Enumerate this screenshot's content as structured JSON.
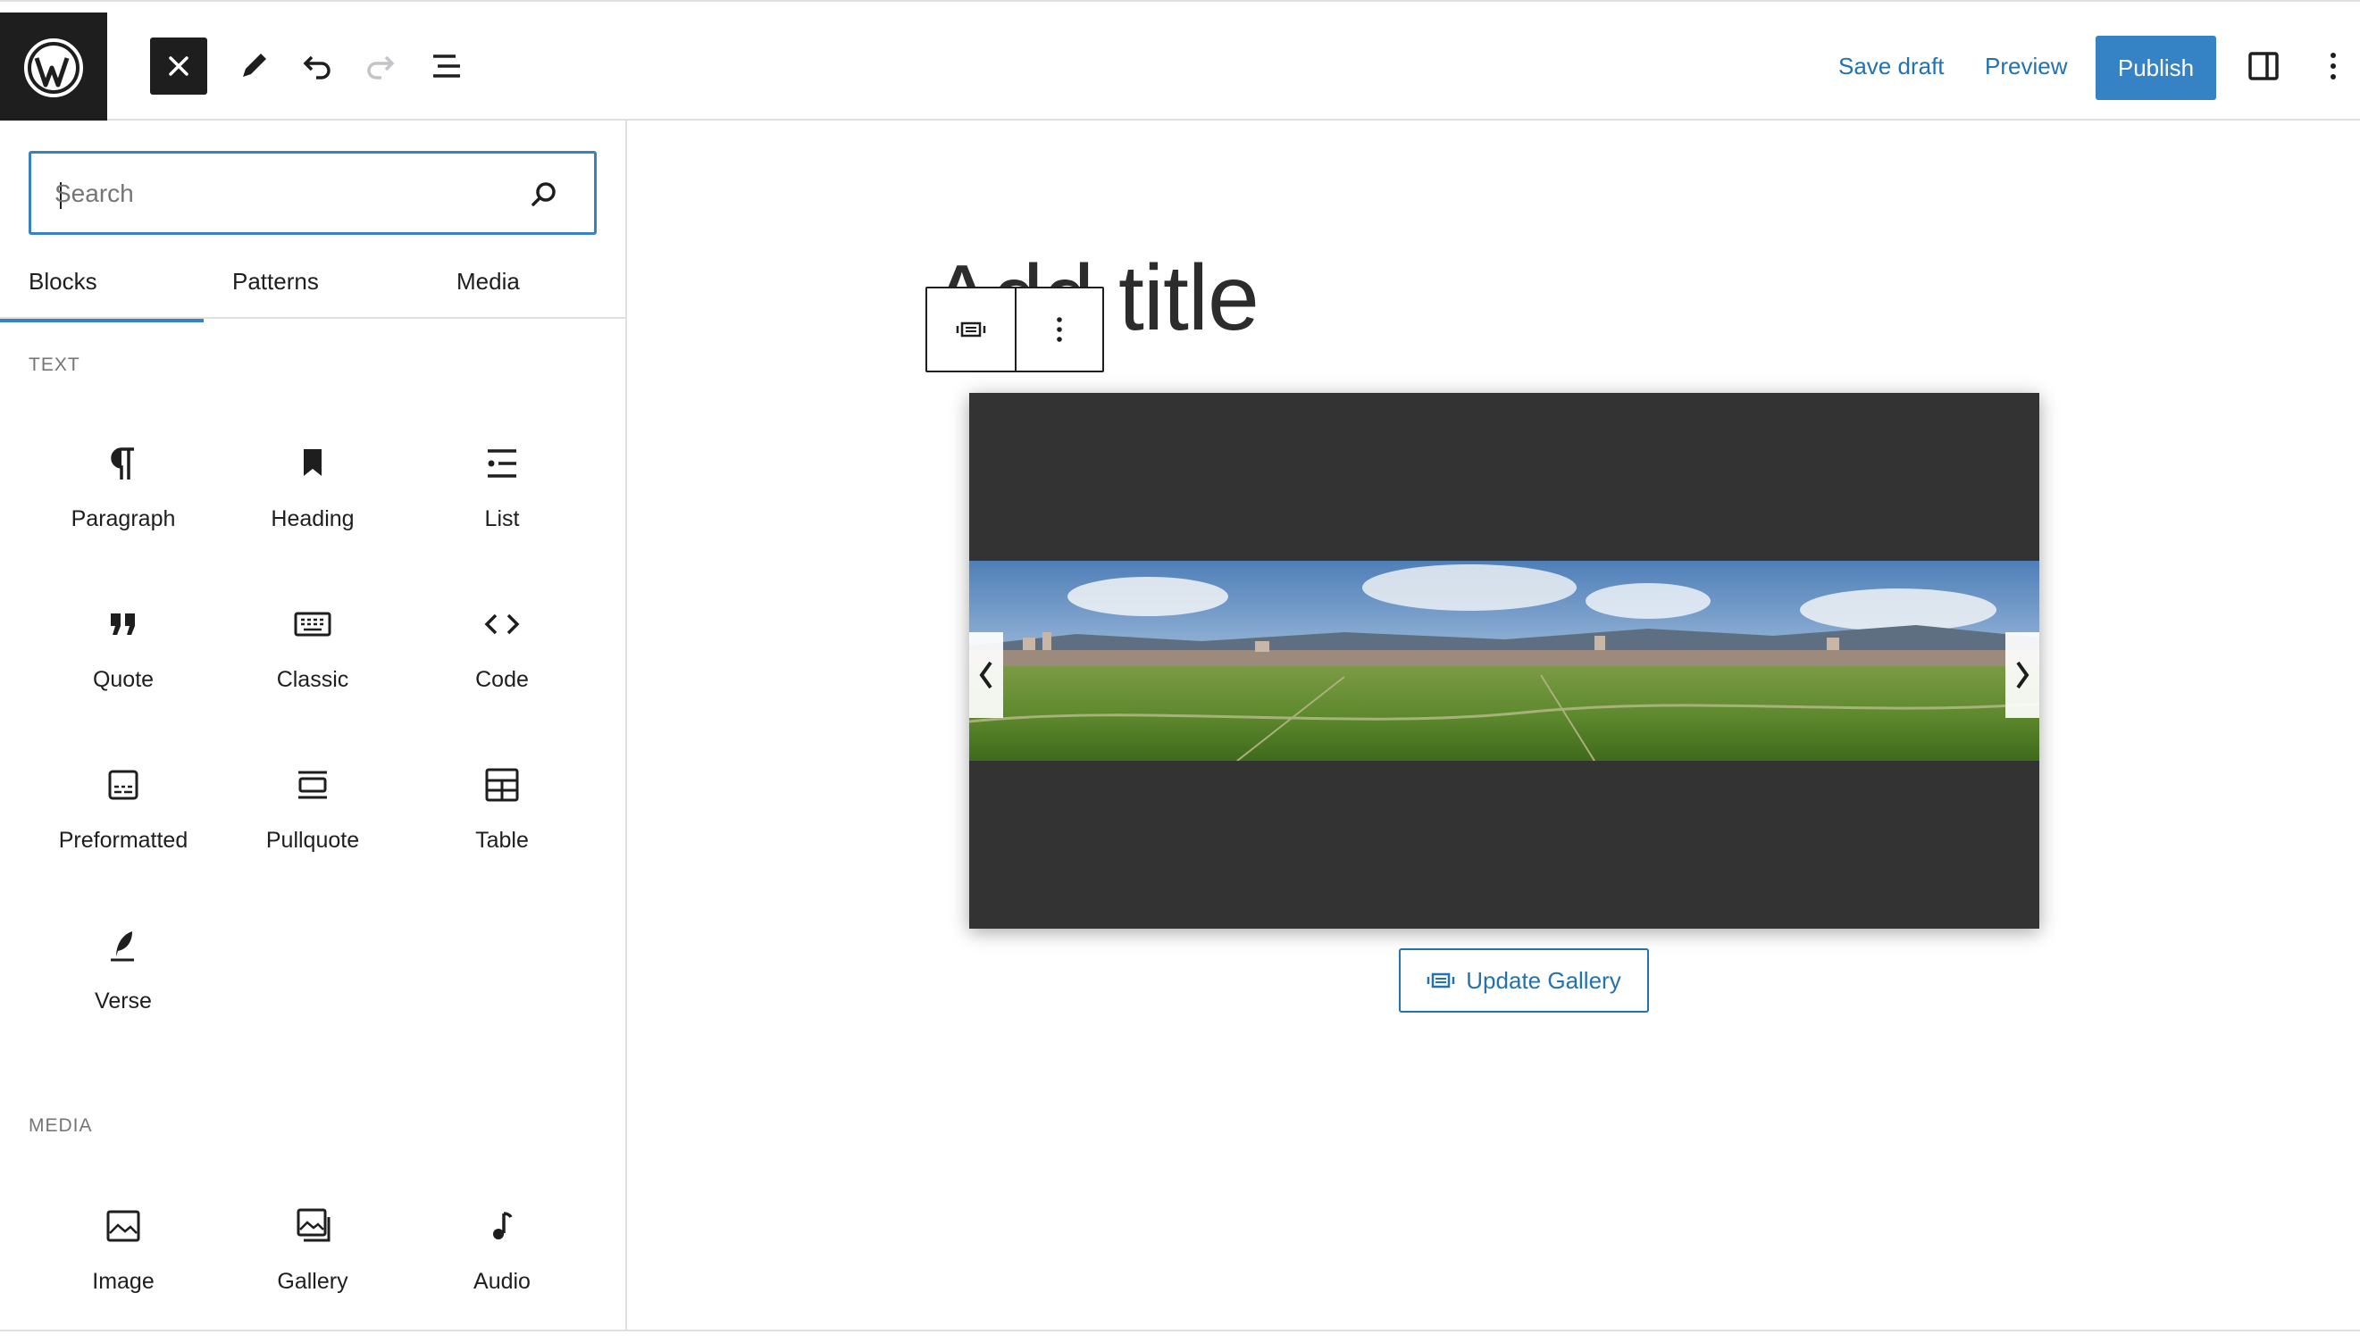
{
  "topbar": {
    "save_draft": "Save draft",
    "preview": "Preview",
    "publish": "Publish",
    "accent_color": "#3582c4"
  },
  "inserter": {
    "search_placeholder": "Search",
    "search_value": "",
    "tabs": [
      {
        "label": "Blocks",
        "selected": true
      },
      {
        "label": "Patterns",
        "selected": false
      },
      {
        "label": "Media",
        "selected": false
      }
    ],
    "sections": [
      {
        "title": "TEXT",
        "blocks": [
          {
            "label": "Paragraph",
            "icon": "paragraph-icon"
          },
          {
            "label": "Heading",
            "icon": "heading-icon"
          },
          {
            "label": "List",
            "icon": "list-icon"
          },
          {
            "label": "Quote",
            "icon": "quote-icon"
          },
          {
            "label": "Classic",
            "icon": "keyboard-icon"
          },
          {
            "label": "Code",
            "icon": "code-icon"
          },
          {
            "label": "Preformatted",
            "icon": "preformatted-icon"
          },
          {
            "label": "Pullquote",
            "icon": "pullquote-icon"
          },
          {
            "label": "Table",
            "icon": "table-icon"
          },
          {
            "label": "Verse",
            "icon": "verse-icon"
          }
        ]
      },
      {
        "title": "MEDIA",
        "blocks": [
          {
            "label": "Image",
            "icon": "image-icon"
          },
          {
            "label": "Gallery",
            "icon": "gallery-icon"
          },
          {
            "label": "Audio",
            "icon": "audio-icon"
          }
        ]
      }
    ]
  },
  "editor": {
    "title_placeholder": "Add title",
    "update_gallery": "Update Gallery"
  }
}
